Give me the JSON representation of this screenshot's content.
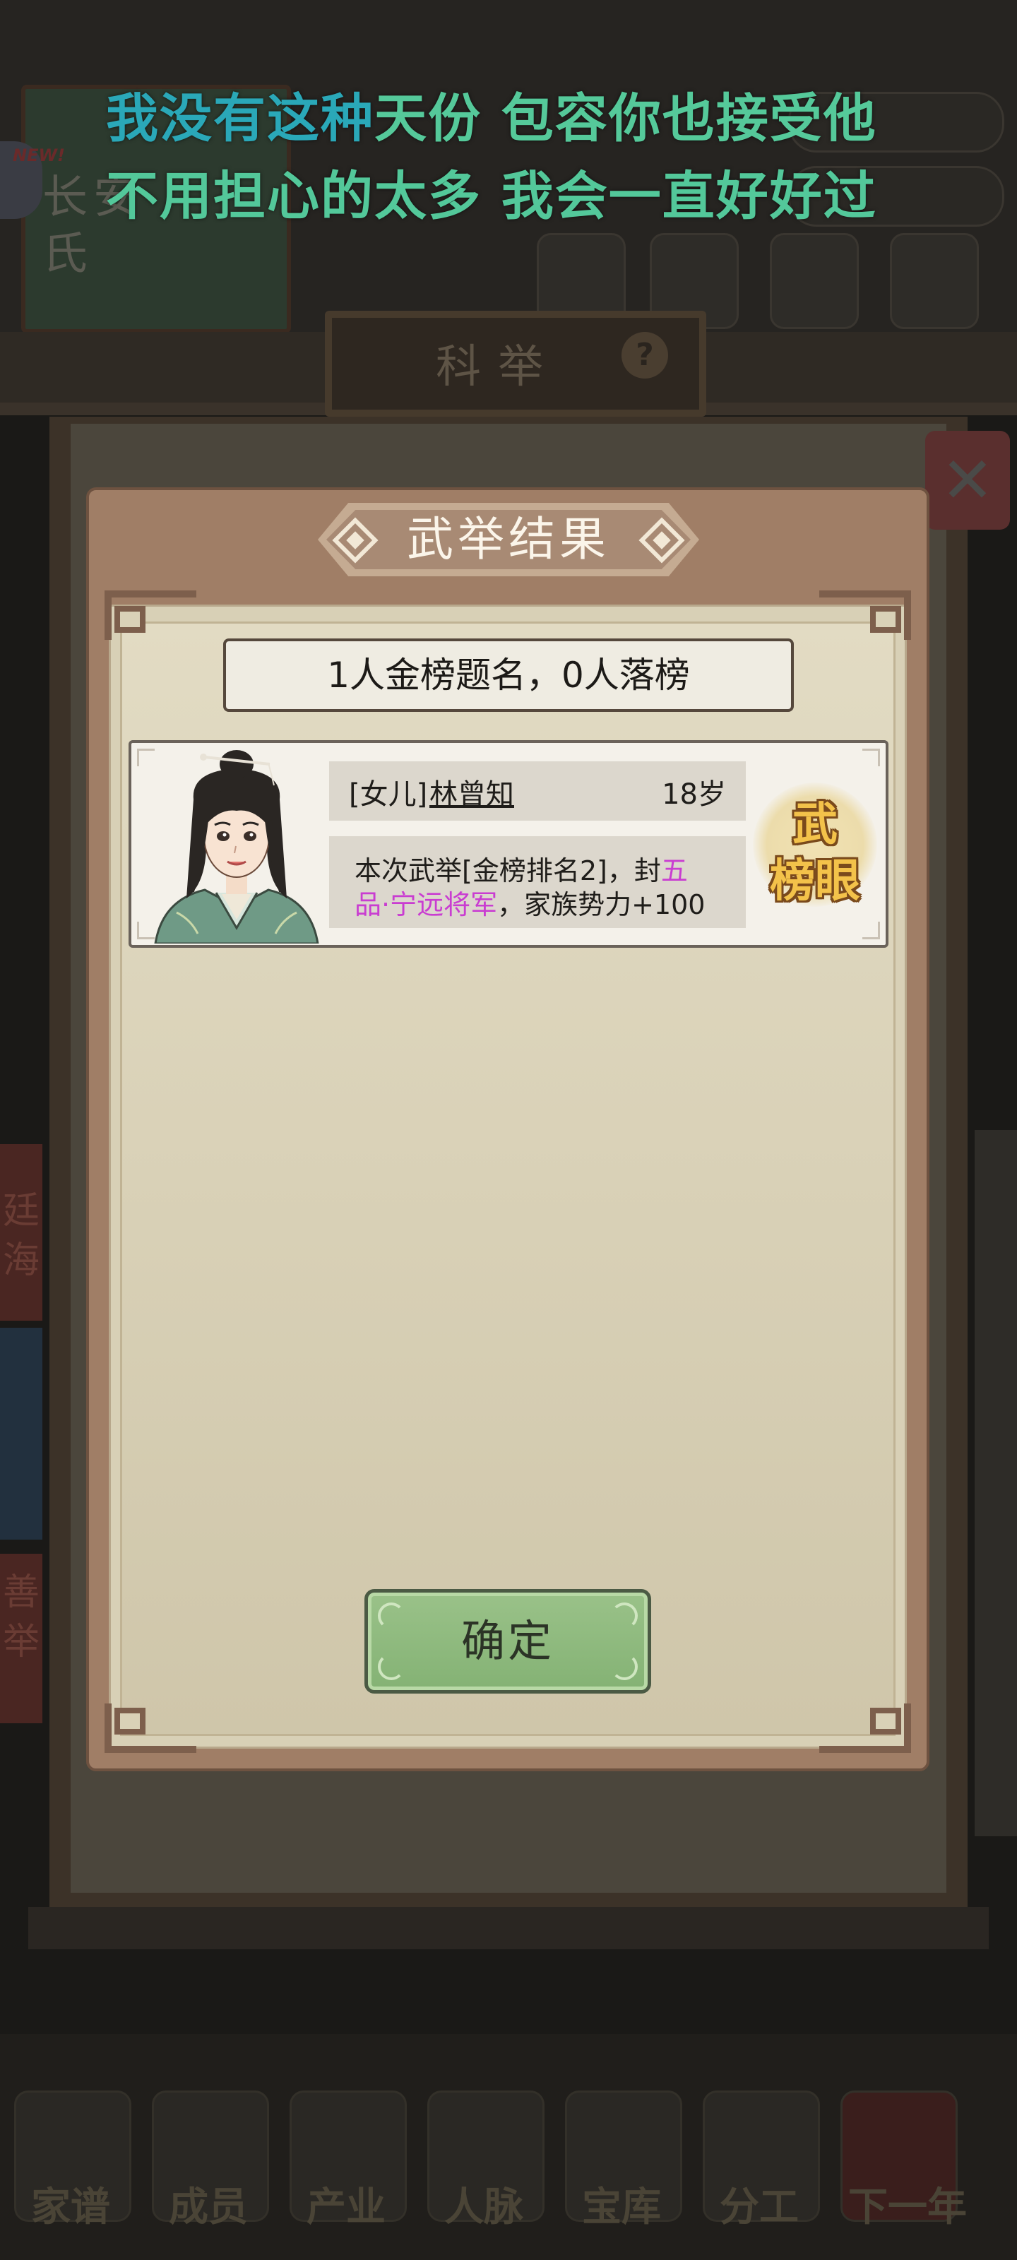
{
  "lyrics": {
    "line1_part1": "我没有这种",
    "line1_part2": "天份 包容你也接受他",
    "line2": "不用担心的太多 我会一直好好过"
  },
  "background": {
    "new_badge": "NEW!",
    "plaque_text": "长安氏",
    "sign_title": "科举",
    "help_icon": "?",
    "close_icon": "✕",
    "side_text_1": "廷海",
    "side_text_2": "善举",
    "nav": [
      "家谱",
      "成员",
      "产业",
      "人脉",
      "宝库",
      "分工",
      "下一年"
    ]
  },
  "modal": {
    "title": "武举结果",
    "summary": "1人金榜题名，0人落榜",
    "result": {
      "relation": "[女儿]",
      "name": "林曾知",
      "age": "18岁",
      "desc_1a": "本次武举[金榜排名2]，封",
      "desc_1b": "五",
      "desc_2a": "品·宁远将军",
      "desc_2b": "，家族势力+100",
      "seal_1": "武",
      "seal_2": "榜眼"
    },
    "confirm_label": "确定"
  },
  "colors": {
    "lyric_cyan": "#2aa8b8",
    "lyric_green": "#55c99a",
    "highlight_pink": "#c93dd1",
    "confirm_green": "#8fbb7e"
  }
}
